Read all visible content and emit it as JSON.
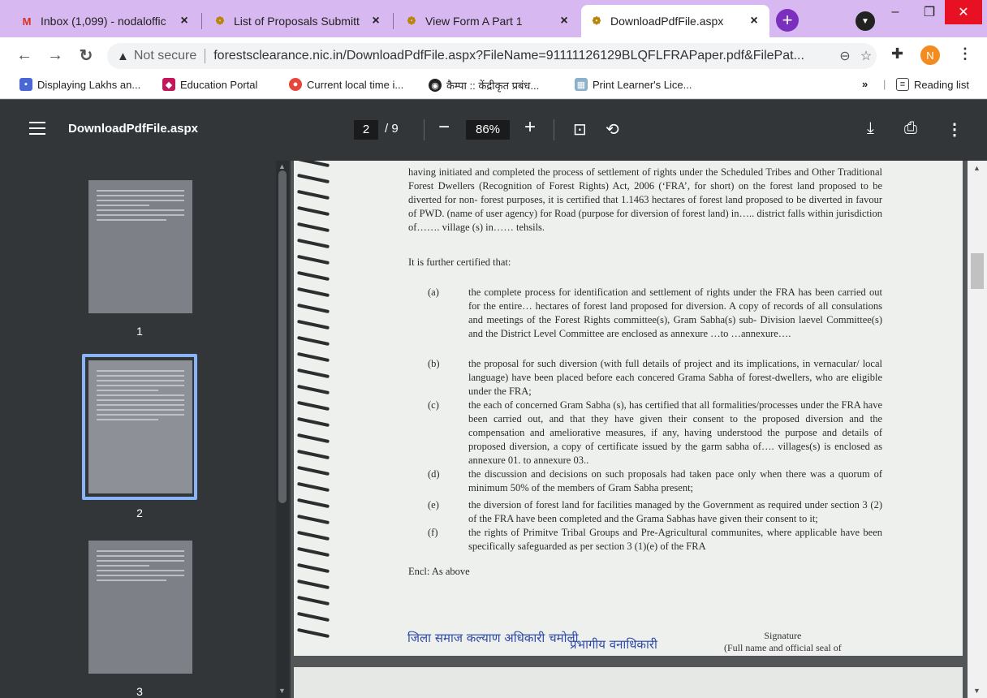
{
  "tabs": [
    {
      "title": "Inbox (1,099) - nodaloffic",
      "icon": "gmail-icon",
      "active": false
    },
    {
      "title": "List of Proposals Submitt",
      "icon": "gov-emblem-icon",
      "active": false
    },
    {
      "title": "View Form A Part 1",
      "icon": "gov-emblem-icon",
      "active": false
    },
    {
      "title": "DownloadPdfFile.aspx",
      "icon": "gov-emblem-icon",
      "active": true
    }
  ],
  "addressbar": {
    "security": "Not secure",
    "url": "forestsclearance.nic.in/DownloadPdfFile.aspx?FileName=91111126129BLQFLFRAPaper.pdf&FilePat..."
  },
  "bookmarks": [
    "Displaying Lakhs an...",
    "Education Portal",
    "Current local time i...",
    "कैम्पा :: केंद्रीकृत प्रबंध...",
    "Print Learner's Lice..."
  ],
  "bookmarks_more": "»",
  "reading_list": "Reading list",
  "profile_initial": "N",
  "pdf": {
    "title": "DownloadPdfFile.aspx",
    "page": "2",
    "total": "/ 9",
    "zoom": "86%"
  },
  "thumbnails": [
    "1",
    "2",
    "3"
  ],
  "document": {
    "para_top": "having initiated and completed the process of settlement of rights under the Scheduled Tribes and Other Traditional Forest Dwellers (Recognition of Forest Rights) Act, 2006 (‘FRA’, for short) on the forest land proposed to be diverted for non- forest purposes, it is certified that 1.1463 hectares of forest land proposed to be diverted in favour of PWD. (name of user agency) for Road (purpose for diversion of forest land) in….. district falls within jurisdiction of……. village (s) in…… tehsils.",
    "further": "It is further certified that:",
    "items": [
      {
        "label": "(a)",
        "text": "the complete process for identification and settlement of rights under the FRA has been carried out for the entire… hectares of forest land proposed for diversion. A copy of records of all consulations and meetings of the Forest Rights committee(s), Gram Sabha(s) sub- Division laevel Committee(s) and the District Level Committee are enclosed as annexure …to …annexure…."
      },
      {
        "label": "(b)",
        "text": "the proposal for such diversion (with full details of project and its implications, in vernacular/ local language) have been placed before each concered Grama Sabha of forest-dwellers, who are eligible under the FRA;"
      },
      {
        "label": "(c)",
        "text": "the each of concerned Gram Sabha (s), has certified that all formalities/processes under the FRA have been carried out, and that they have given their consent to the proposed diversion and the compensation and ameliorative measures, if any, having understood the purpose and details of proposed diversion, a copy of certificate issued by the garm sabha of…. villages(s) is enclosed as annexure 01. to annexure 03.."
      },
      {
        "label": "(d)",
        "text": "the discussion and decisions on such proposals had taken pace only when there was a quorum of minimum 50% of the members of Gram Sabha present;"
      },
      {
        "label": "(e)",
        "text": "the diversion of forest land for facilities managed by the Government as required under section 3 (2) of the FRA have been completed and the Grama Sabhas have given their consent to it;"
      },
      {
        "label": "(f)",
        "text": "the rights of Primitve Tribal Groups and Pre-Agricultural communites, where applicable have been specifically safeguarded as per section 3 (1)(e) of the FRA"
      }
    ],
    "encl": "Encl: As above",
    "stamp_left": "जिला समाज कल्याण अधिकारी चमोली",
    "stamp_mid": "प्रभागीय वनाधिकारी",
    "signature_label": "Signature",
    "signature_sub": "(Full name and official seal of"
  }
}
